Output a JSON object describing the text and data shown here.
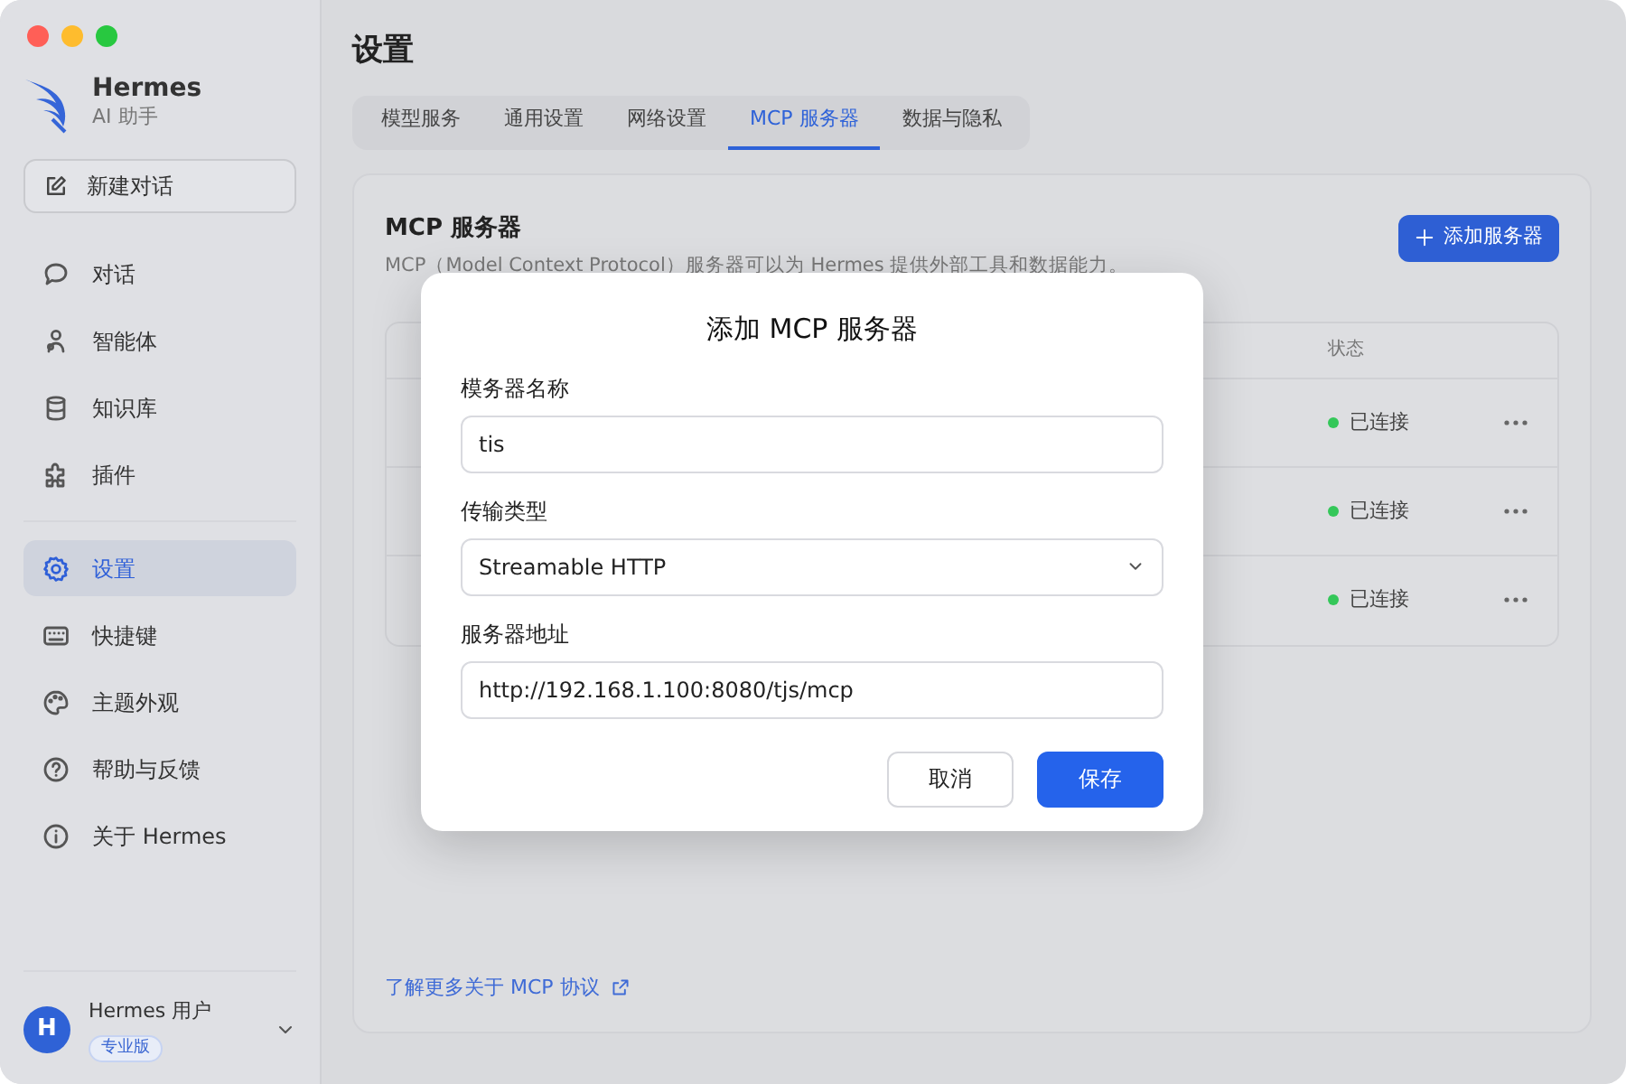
{
  "window": {
    "traffic_lights": [
      {
        "color": "#ff5f57"
      },
      {
        "color": "#febc2e"
      },
      {
        "color": "#28c840"
      }
    ]
  },
  "brand": {
    "name": "Hermes",
    "subtitle": "AI 助手"
  },
  "new_chat": {
    "label": "新建对话"
  },
  "sidebar": {
    "items": [
      {
        "label": "对话",
        "selected": false
      },
      {
        "label": "智能体",
        "selected": false
      },
      {
        "label": "知识库",
        "selected": false
      },
      {
        "label": "插件",
        "selected": false
      },
      {
        "label": "设置",
        "selected": true
      },
      {
        "label": "快捷键",
        "selected": false
      },
      {
        "label": "主题外观",
        "selected": false
      },
      {
        "label": "帮助与反馈",
        "selected": false
      },
      {
        "label": "关于 Hermes",
        "selected": false
      }
    ]
  },
  "user": {
    "initial": "H",
    "name": "Hermes 用户",
    "plan": "专业版"
  },
  "page": {
    "title": "设置"
  },
  "tabs": [
    {
      "label": "模型服务",
      "selected": false
    },
    {
      "label": "通用设置",
      "selected": false
    },
    {
      "label": "网络设置",
      "selected": false
    },
    {
      "label": "MCP 服务器",
      "selected": true
    },
    {
      "label": "数据与隐私",
      "selected": false
    }
  ],
  "section": {
    "title": "MCP 服务器",
    "description": "MCP（Model Context Protocol）服务器可以为 Hermes 提供外部工具和数据能力。",
    "add_button": "添加服务器"
  },
  "table": {
    "columns": [
      "状态"
    ],
    "rows": [
      {
        "status": "已连接",
        "color": "#34c759"
      },
      {
        "status": "已连接",
        "color": "#34c759"
      },
      {
        "status": "已连接",
        "color": "#34c759"
      }
    ]
  },
  "learn_more": "了解更多关于 MCP 协议",
  "dialog": {
    "title": "添加 MCP 服务器",
    "fields": [
      {
        "kind": "text",
        "label": "模务器名称",
        "value": "tis"
      },
      {
        "kind": "select",
        "label": "传输类型",
        "value": "Streamable HTTP"
      },
      {
        "kind": "text",
        "label": "服务器地址",
        "value": "http://192.168.1.100:8080/tjs/mcp"
      }
    ],
    "buttons": [
      {
        "label": "取消",
        "kind": "secondary"
      },
      {
        "label": "保存",
        "kind": "primary"
      }
    ]
  }
}
